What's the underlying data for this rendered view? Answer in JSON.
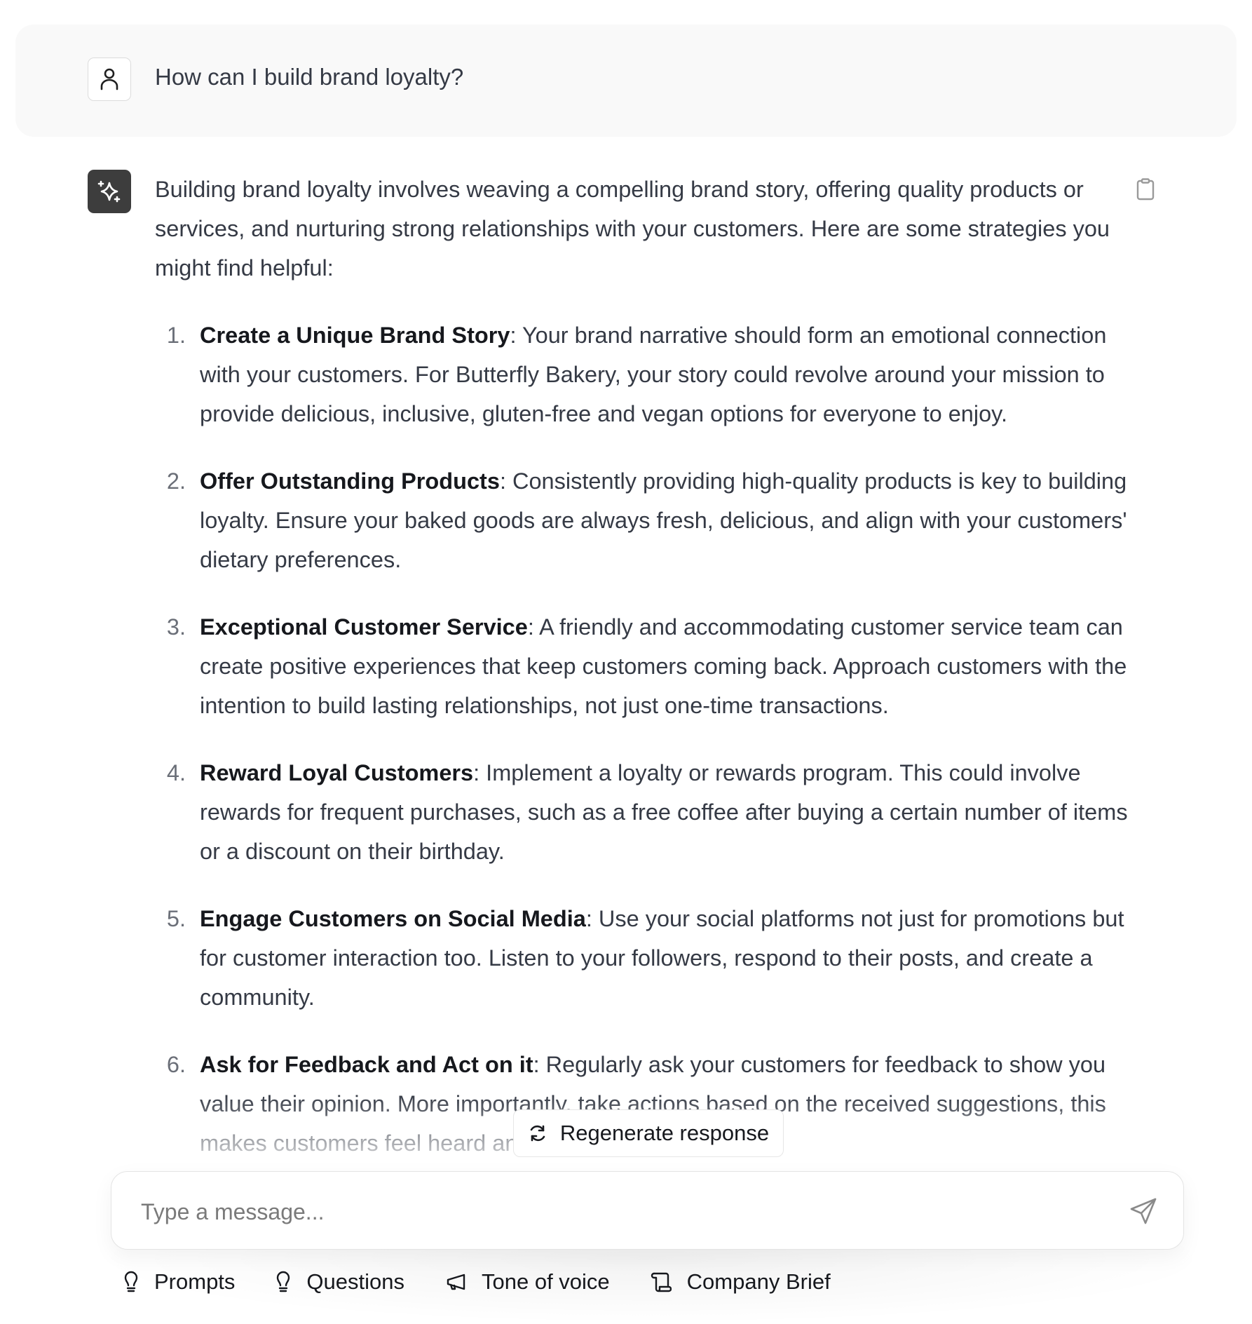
{
  "user_message": {
    "avatar_icon": "user-icon",
    "text": "How can I build brand loyalty?"
  },
  "assistant_message": {
    "avatar_icon": "sparkles-icon",
    "copy_icon": "clipboard-icon",
    "intro": "Building brand loyalty involves weaving a compelling brand story, offering quality products or services, and nurturing strong relationships with your customers. Here are some strategies you might find helpful:",
    "items": [
      {
        "number": "1.",
        "title": "Create a Unique Brand Story",
        "text": ": Your brand narrative should form an emotional connection with your customers. For Butterfly Bakery, your story could revolve around your mission to provide delicious, inclusive, gluten-free and vegan options for everyone to enjoy."
      },
      {
        "number": "2.",
        "title": "Offer Outstanding Products",
        "text": ": Consistently providing high-quality products is key to building loyalty. Ensure your baked goods are always fresh, delicious, and align with your customers' dietary preferences."
      },
      {
        "number": "3.",
        "title": "Exceptional Customer Service",
        "text": ": A friendly and accommodating customer service team can create positive experiences that keep customers coming back. Approach customers with the intention to build lasting relationships, not just one-time transactions."
      },
      {
        "number": "4.",
        "title": "Reward Loyal Customers",
        "text": ": Implement a loyalty or rewards program. This could involve rewards for frequent purchases, such as a free coffee after buying a certain number of items or a discount on their birthday."
      },
      {
        "number": "5.",
        "title": "Engage Customers on Social Media",
        "text": ": Use your social platforms not just for promotions but for customer interaction too. Listen to your followers, respond to their posts, and create a community."
      },
      {
        "number": "6.",
        "title": "Ask for Feedback and Act on it",
        "text": ": Regularly ask your customers for feedback to show you value their opinion. More importantly, take actions based on the received suggestions, this makes customers feel heard and valued."
      }
    ]
  },
  "regenerate": {
    "icon": "refresh-icon",
    "label": "Regenerate response"
  },
  "composer": {
    "placeholder": "Type a message...",
    "value": "",
    "send_icon": "send-icon"
  },
  "toolbar": {
    "items": [
      {
        "icon": "lightbulb-icon",
        "label": "Prompts"
      },
      {
        "icon": "lightbulb-icon",
        "label": "Questions"
      },
      {
        "icon": "megaphone-icon",
        "label": "Tone of voice"
      },
      {
        "icon": "scroll-icon",
        "label": "Company Brief"
      }
    ]
  },
  "colors": {
    "user_bubble_bg": "#f9f9f9",
    "ai_avatar_bg": "#3d3d3d",
    "body_text": "#353a45",
    "bold_text": "#16181d",
    "icon_gray": "#8a8a8a"
  }
}
